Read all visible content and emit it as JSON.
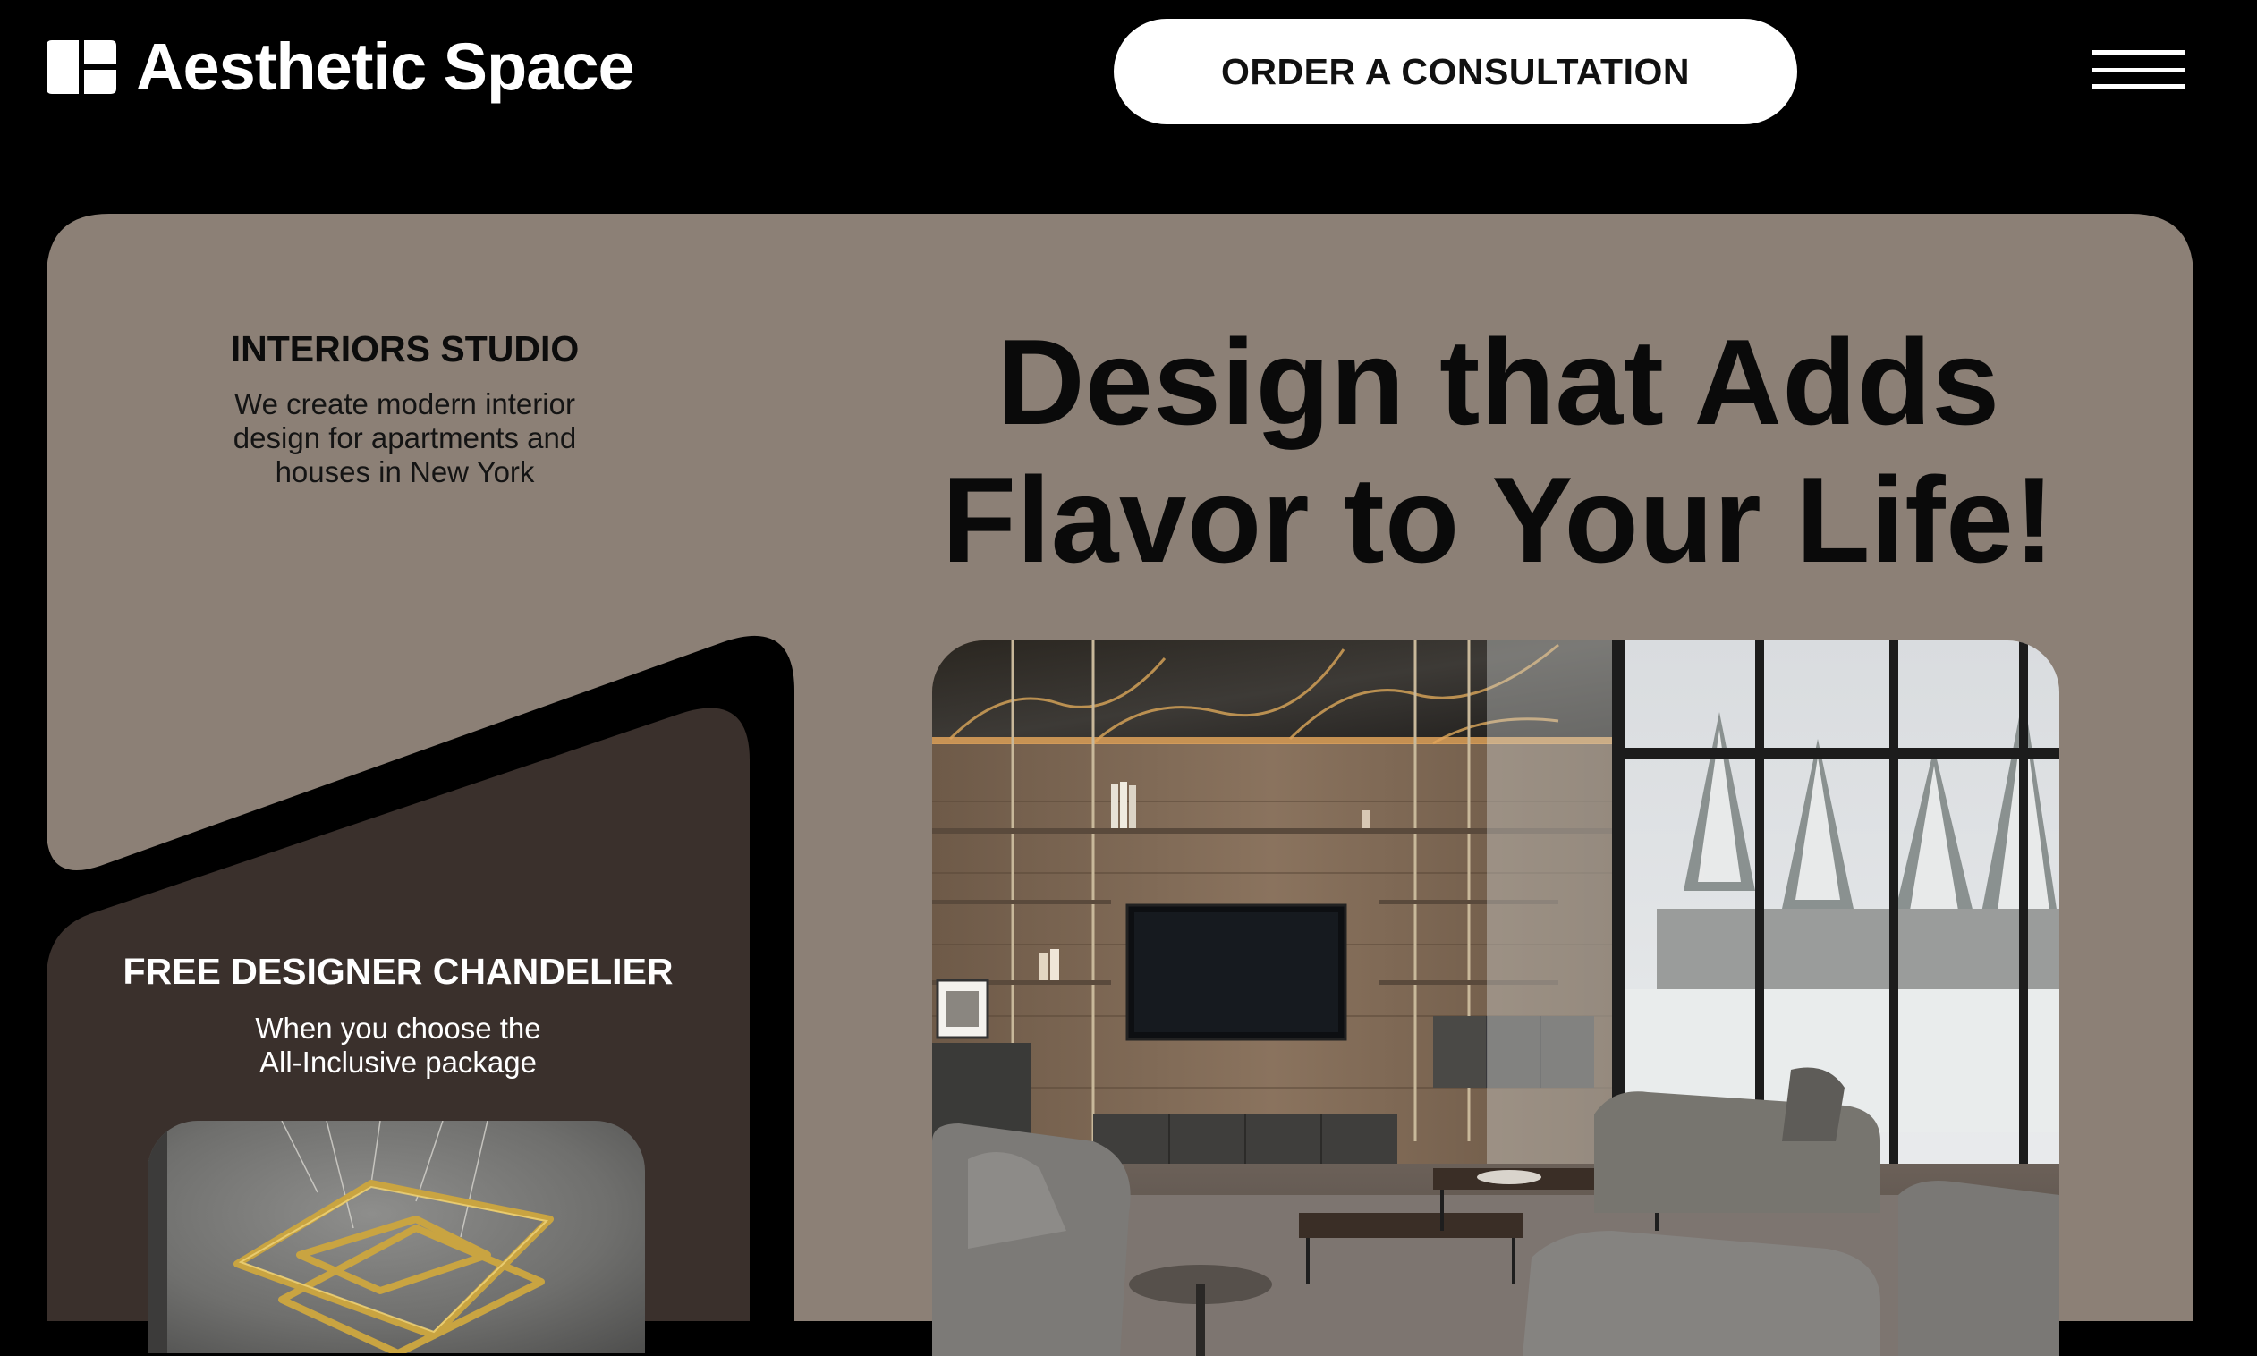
{
  "header": {
    "brand": "Aesthetic Space",
    "cta_label": "ORDER A CONSULTATION"
  },
  "studio": {
    "title": "INTERIORS STUDIO",
    "description_lines": [
      "We create modern interior",
      "design for apartments and",
      "houses in New York"
    ]
  },
  "hero": {
    "headline_lines": [
      "Design that Adds",
      "Flavor to Your Life!"
    ]
  },
  "promo": {
    "title": "FREE DESIGNER CHANDELIER",
    "text_lines": [
      "When you choose the",
      "All-Inclusive package"
    ]
  },
  "icons": {
    "logo": "grid-logo-icon",
    "menu": "hamburger-menu-icon"
  },
  "colors": {
    "page_background": "#000000",
    "card_background": "#8c8076",
    "promo_background": "#3a302c",
    "cta_background": "#ffffff",
    "accent_gold": "#c9a441"
  }
}
